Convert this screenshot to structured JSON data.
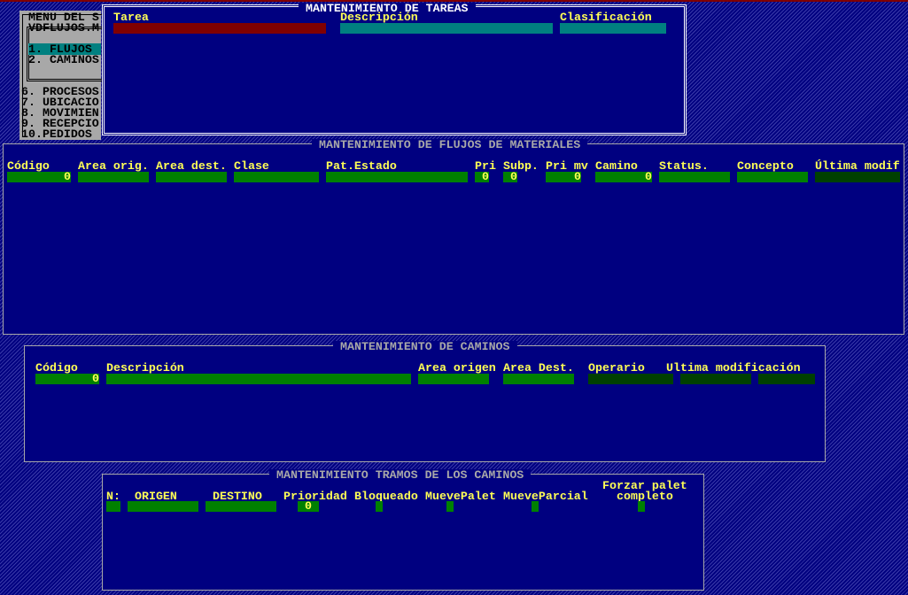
{
  "menu": {
    "title_lines": [
      "MENU DEL S",
      "VDFLUJOS.M"
    ],
    "items": [
      "1. FLUJOS",
      "2. CAMINOS",
      "6. PROCESOS",
      "7. UBICACIO",
      "8. MOVIMIEN",
      "9. RECEPCIO",
      "10.PEDIDOS"
    ],
    "selected": 0
  },
  "tareas": {
    "title": "MANTENIMIENTO DE TAREAS",
    "labels": [
      "Tarea",
      "Descripción",
      "Clasificación"
    ]
  },
  "flujos": {
    "title": "MANTENIMIENTO DE FLUJOS DE MATERIALES",
    "labels": [
      "Código",
      "Area orig.",
      "Area dest.",
      "Clase",
      "Pat.Estado",
      "Pri",
      "Subp.",
      "Pri mv",
      "Camino",
      "Status.",
      "Concepto",
      "Última modif"
    ],
    "values": [
      "0",
      "",
      "",
      "",
      "",
      "0",
      "0",
      "0",
      "0",
      "",
      "",
      ""
    ]
  },
  "caminos": {
    "title": "MANTENIMIENTO DE CAMINOS",
    "labels": [
      "Código",
      "Descripción",
      "Area origen",
      "Area Dest.",
      "Operario",
      "Ultima modificación"
    ],
    "values": [
      "0",
      "",
      "",
      "",
      "",
      "",
      ""
    ]
  },
  "tramos": {
    "title": "MANTENIMIENTO TRAMOS DE LOS CAMINOS",
    "labels": [
      "N:",
      "ORIGEN",
      "DESTINO",
      "Prioridad",
      "Bloqueado",
      "MuevePalet",
      "MueveParcial",
      "Forzar palet",
      "completo"
    ],
    "values": [
      "",
      "",
      "",
      "0",
      "",
      "",
      "",
      ""
    ]
  },
  "colors": {
    "background": "#000080",
    "label": "#ffff55",
    "field": "#008000",
    "field_readonly": "#004000",
    "field_active": "#800000",
    "field_teal": "#008080"
  }
}
